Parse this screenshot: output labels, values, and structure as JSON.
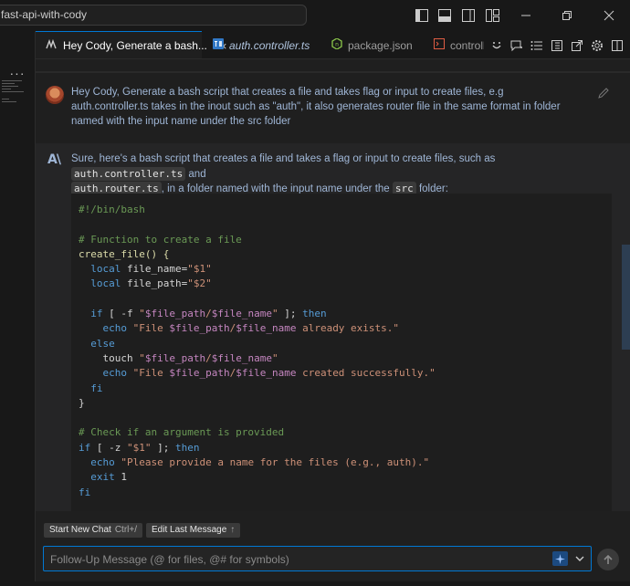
{
  "titlebar": {
    "search_text": "fast-api-with-cody",
    "controls": [
      "toggle-primary-sidebar-icon",
      "toggle-panel-icon",
      "toggle-secondary-sidebar-icon",
      "customize-layout-icon"
    ],
    "window_controls": [
      "minimize-icon",
      "restore-icon",
      "close-icon"
    ]
  },
  "sidebar": {
    "more_label": "···"
  },
  "tabs": [
    {
      "label": "Hey Cody, Generate a bash...",
      "icon": "cody-chat-icon",
      "active": true,
      "close": "×"
    },
    {
      "label": "auth.controller.ts",
      "icon": "typescript-file-icon",
      "active": false
    },
    {
      "label": "package.json",
      "icon": "nodejs-file-icon",
      "active": false
    },
    {
      "label": "controll",
      "icon": "terminal-file-icon",
      "active": false
    }
  ],
  "tab_actions": [
    "cody-commands-icon",
    "new-chat-icon",
    "chat-history-icon",
    "split-editor-icon",
    "open-external-icon",
    "settings-gear-icon",
    "toggle-split-icon"
  ],
  "chat": {
    "human_message": "Hey Cody, Generate a bash script that creates a file and takes flag or input to create files, e.g auth.controller.ts takes in the inout such as \"auth\", it also generates router file in the same format in folder named with the input name under the src folder",
    "bot_logo": "A\\",
    "bot_intro": {
      "p1": "Sure, here's a bash script that creates a file and takes a flag or input to create files, such as ",
      "code1": "auth.controller.ts",
      "p2": " and ",
      "code2": "auth.router.ts",
      "p3": ", in a folder named with the input name under the ",
      "code3": "src",
      "p4": " folder:"
    },
    "code": {
      "shebang": "#!/bin/bash",
      "comment1": "# Function to create a file",
      "fn_name": "create_file() {",
      "local1_kw": "local",
      "local1_name": "file_name=",
      "local1_val": "\"$1\"",
      "local2_kw": "local",
      "local2_name": "file_path=",
      "local2_val": "\"$2\"",
      "if_kw": "if",
      "if_open": " [ -f ",
      "if_q1": "\"",
      "if_var1": "$file_path",
      "if_slash": "/",
      "if_var2": "$file_name",
      "if_q2": "\"",
      "if_close": " ]; ",
      "then1": "then",
      "echo1_cmd": "echo",
      "echo1_q": " \"File ",
      "echo1_v1": "$file_path",
      "echo1_s": "/",
      "echo1_v2": "$file_name",
      "echo1_rest": " already exists.\"",
      "else_kw": "else",
      "touch_cmd": "touch",
      "touch_q": " \"",
      "touch_v1": "$file_path",
      "touch_s": "/",
      "touch_v2": "$file_name",
      "touch_end": "\"",
      "echo2_cmd": "echo",
      "echo2_q": " \"File ",
      "echo2_v1": "$file_path",
      "echo2_s": "/",
      "echo2_v2": "$file_name",
      "echo2_rest": " created successfully.\"",
      "fi1": "fi",
      "brace_close": "}",
      "comment2": "# Check if an argument is provided",
      "if2_kw": "if",
      "if2_open": " [ -z ",
      "if2_val": "\"$1\"",
      "if2_close": " ]; ",
      "then2": "then",
      "echo3_cmd": "echo",
      "echo3_str": " \"Please provide a name for the files (e.g., auth).\"",
      "exit_cmd": "exit",
      "exit_val": " 1",
      "fi2": "fi"
    }
  },
  "bottom": {
    "chip_new_chat": "Start New Chat",
    "chip_new_chat_key": "Ctrl+/",
    "chip_edit_last": "Edit Last Message",
    "chip_edit_last_key": "↑",
    "followup_placeholder": "Follow-Up Message (@ for files, @# for symbols)"
  },
  "colors": {
    "accent": "#0078d4",
    "comment": "#6a9955",
    "keyword": "#569cd6",
    "string": "#ce9178",
    "variable": "#c586c0"
  }
}
